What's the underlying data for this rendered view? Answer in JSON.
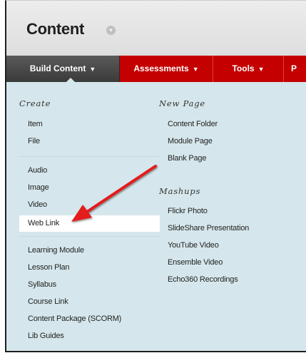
{
  "page": {
    "title": "Content"
  },
  "tabs": [
    {
      "label": "Build Content",
      "chevron": "⌄"
    },
    {
      "label": "Assessments",
      "chevron": "⌄"
    },
    {
      "label": "Tools",
      "chevron": "⌄"
    },
    {
      "label": "P"
    }
  ],
  "menu": {
    "create": {
      "heading": "Create",
      "group1": [
        "Item",
        "File"
      ],
      "group2": [
        "Audio",
        "Image",
        "Video",
        "Web Link"
      ],
      "group3": [
        "Learning Module",
        "Lesson Plan",
        "Syllabus",
        "Course Link",
        "Content Package (SCORM)",
        "Lib Guides"
      ]
    },
    "new_page": {
      "heading": "New Page",
      "items": [
        "Content Folder",
        "Module Page",
        "Blank Page"
      ]
    },
    "mashups": {
      "heading": "Mashups",
      "items": [
        "Flickr Photo",
        "SlideShare Presentation",
        "YouTube Video",
        "Ensemble Video",
        "Echo360 Recordings"
      ]
    }
  },
  "colors": {
    "nav": "#c40000",
    "active_tab": "#444444",
    "menu_bg": "#d5e7ec",
    "arrow": "#e31d1d"
  },
  "icons": {
    "title_menu": "chevron-down-icon",
    "tab_menu": "chevron-down-icon",
    "annotation": "red-arrow"
  }
}
